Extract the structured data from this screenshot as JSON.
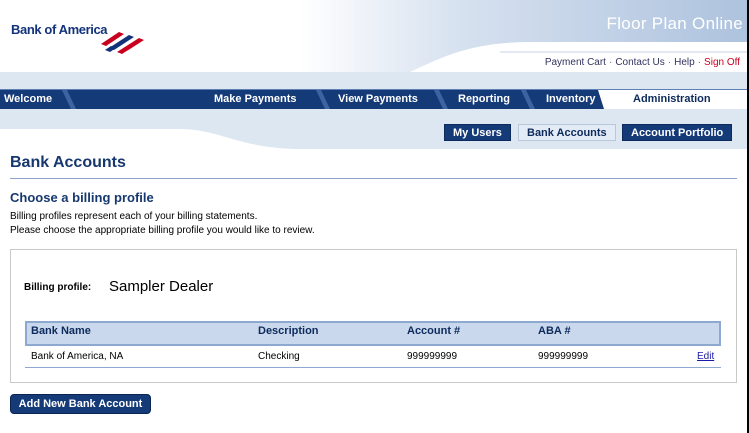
{
  "header": {
    "logo_text": "Bank of America",
    "app_title": "Floor Plan Online",
    "util_links": [
      "Payment Cart",
      "Contact Us",
      "Help"
    ],
    "sign_off": "Sign Off"
  },
  "main_nav": {
    "items": [
      "Welcome",
      "Make Payments",
      "View Payments",
      "Reporting",
      "Inventory"
    ],
    "active": "Administration"
  },
  "sub_nav": {
    "items": [
      "My Users",
      "Bank Accounts",
      "Account Portfolio"
    ],
    "active": "Bank Accounts"
  },
  "page": {
    "title": "Bank Accounts",
    "section_title": "Choose a billing profile",
    "desc_line1": "Billing profiles represent each of your billing statements.",
    "desc_line2": "Please choose the appropriate billing profile you would like to review."
  },
  "billing_profile": {
    "label": "Billing profile:",
    "value": "Sampler Dealer"
  },
  "table": {
    "headers": [
      "Bank Name",
      "Description",
      "Account #",
      "ABA #"
    ],
    "rows": [
      {
        "bank_name": "Bank of America, NA",
        "description": "Checking",
        "account": "999999999",
        "aba": "999999999",
        "action": "Edit"
      }
    ]
  },
  "actions": {
    "add_button": "Add New Bank Account"
  },
  "colors": {
    "brand_navy": "#143a78",
    "brand_red": "#c8001e",
    "header_swoosh": "#b8c9e1"
  }
}
